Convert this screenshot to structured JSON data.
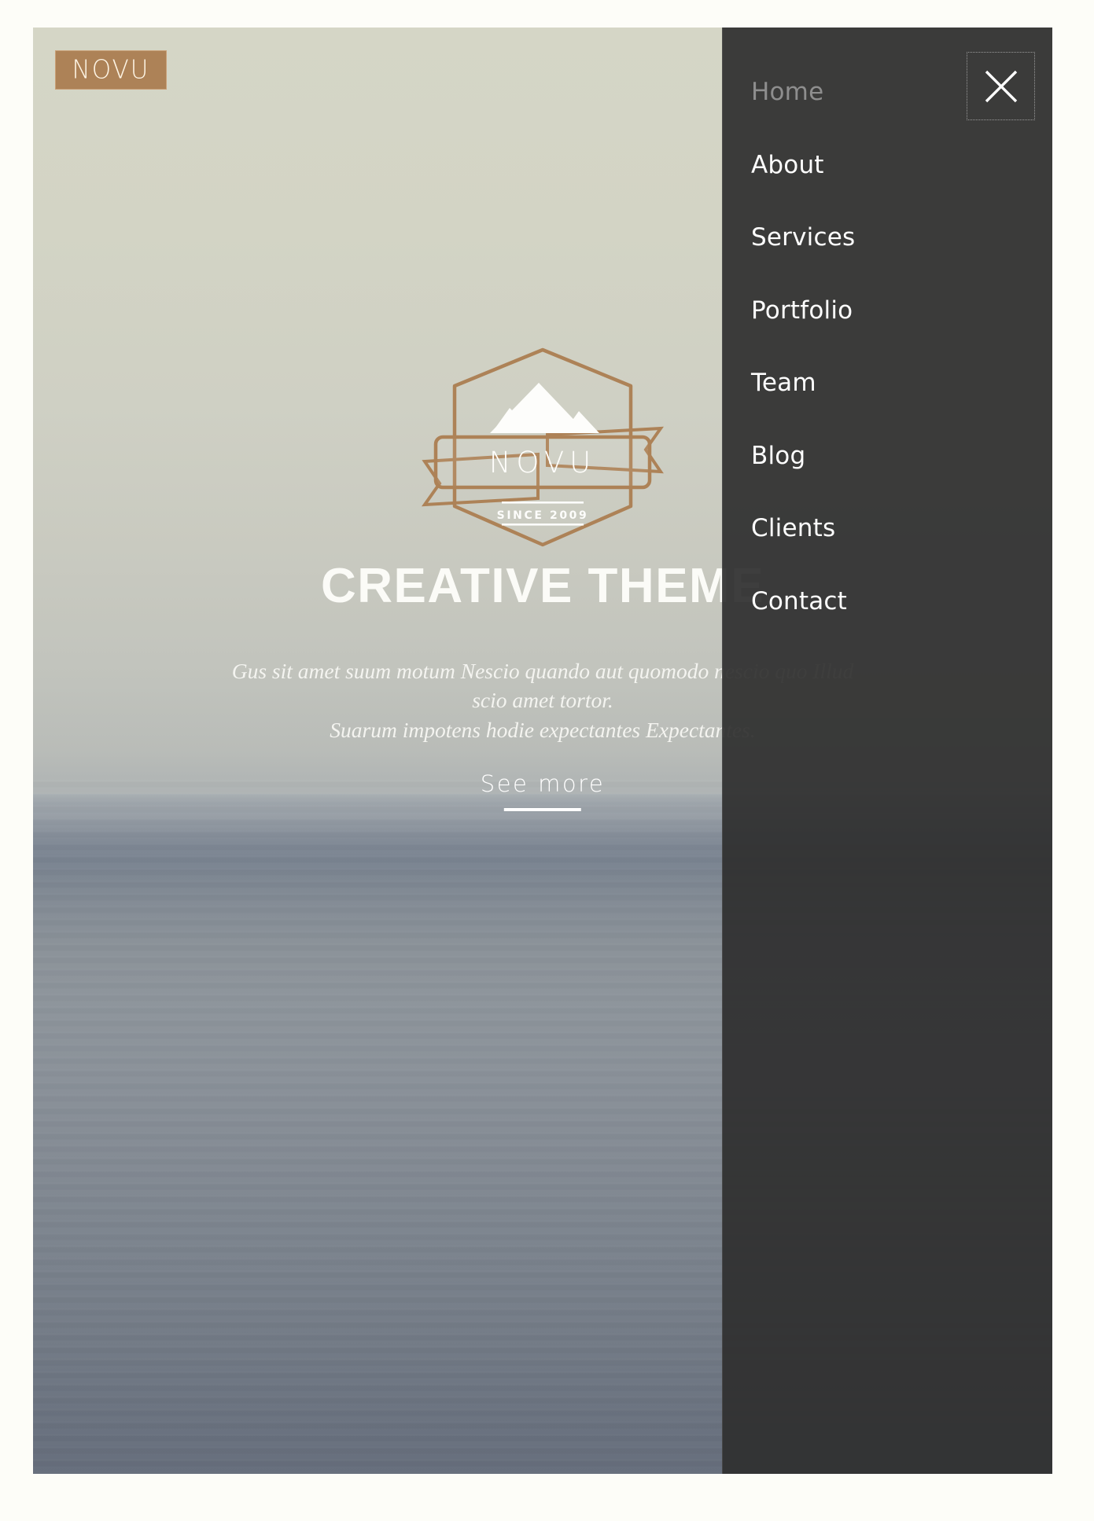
{
  "brand": {
    "logo_text": "NOVU",
    "logo_bg_color": "#ad8257",
    "logo_text_color": "#fdf4e4"
  },
  "hero": {
    "headline": "CREATIVE THEME",
    "subtitle_line_1": "Gus sit amet suum motum Nescio quando aut quomodo nescio quo Illud",
    "subtitle_line_2": "scio amet tortor.",
    "subtitle_line_3": "Suarum impotens hodie expectantes Expectantes.",
    "cta_label": "See more",
    "badge": {
      "name": "NOVU",
      "tagline": "SINCE 2009",
      "outline_color": "#ad8257",
      "icon": "mountain-icon"
    }
  },
  "nav": {
    "close_icon": "close-icon",
    "active_item": "Home",
    "items": [
      {
        "label": "Home",
        "name": "nav-item-home",
        "active": true
      },
      {
        "label": "About",
        "name": "nav-item-about",
        "active": false
      },
      {
        "label": "Services",
        "name": "nav-item-services",
        "active": false
      },
      {
        "label": "Portfolio",
        "name": "nav-item-portfolio",
        "active": false
      },
      {
        "label": "Team",
        "name": "nav-item-team",
        "active": false
      },
      {
        "label": "Blog",
        "name": "nav-item-blog",
        "active": false
      },
      {
        "label": "Clients",
        "name": "nav-item-clients",
        "active": false
      },
      {
        "label": "Contact",
        "name": "nav-item-contact",
        "active": false
      }
    ]
  },
  "theme": {
    "panel_bg": "#2f2f2f",
    "accent": "#ad8257",
    "text_light": "#fefefe",
    "text_muted": "#8e8e8e"
  }
}
